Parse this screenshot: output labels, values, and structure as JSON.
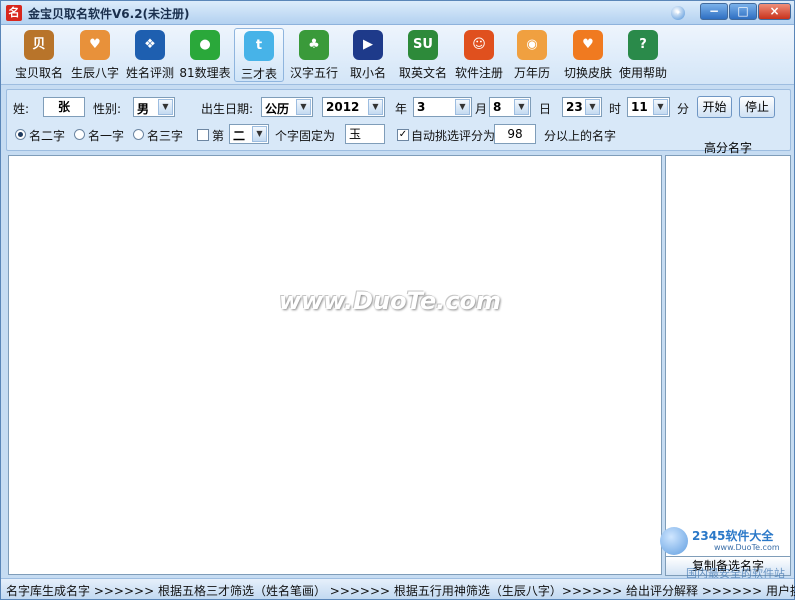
{
  "window": {
    "title": "金宝贝取名软件V6.2(未注册)"
  },
  "toolbar": [
    {
      "label": "宝贝取名",
      "icon": "baby-naming-icon",
      "color": "#b8742a",
      "glyph": "贝"
    },
    {
      "label": "生辰八字",
      "icon": "heart-hands-icon",
      "color": "#e8913a",
      "glyph": "♥"
    },
    {
      "label": "姓名评测",
      "icon": "name-test-icon",
      "color": "#1e5fb0",
      "glyph": "❖"
    },
    {
      "label": "81数理表",
      "icon": "chat-bubble-icon",
      "color": "#2aa83a",
      "glyph": "●"
    },
    {
      "label": "三才表",
      "icon": "bird-icon",
      "color": "#47b3e8",
      "glyph": "t"
    },
    {
      "label": "汉字五行",
      "icon": "users-icon",
      "color": "#3a9a3a",
      "glyph": "♣"
    },
    {
      "label": "取小名",
      "icon": "car-icon",
      "color": "#1e3a8a",
      "glyph": "▶"
    },
    {
      "label": "取英文名",
      "icon": "stumble-icon",
      "color": "#2d8a3a",
      "glyph": "SU"
    },
    {
      "label": "软件注册",
      "icon": "robot-icon",
      "color": "#e0501e",
      "glyph": "☺"
    },
    {
      "label": "万年历",
      "icon": "calendar-icon",
      "color": "#f0a040",
      "glyph": "◉"
    },
    {
      "label": "切换皮肤",
      "icon": "skin-heart-icon",
      "color": "#f07a20",
      "glyph": "♥"
    },
    {
      "label": "使用帮助",
      "icon": "help-book-icon",
      "color": "#2a8a4a",
      "glyph": "?"
    }
  ],
  "form": {
    "surname_label": "姓:",
    "surname_value": "张",
    "gender_label": "性别:",
    "gender_value": "男",
    "birth_label": "出生日期:",
    "calendar_value": "公历",
    "year_value": "2012",
    "year_label": "年",
    "month_value": "3",
    "month_label": "月",
    "day_value": "8",
    "day_label": "日",
    "hour_value": "23",
    "hour_label": "时",
    "minute_value": "11",
    "minute_label": "分",
    "start_label": "开始",
    "stop_label": "停止",
    "radio_two": "名二字",
    "radio_one": "名一字",
    "radio_three": "名三字",
    "nth_label": "第",
    "nth_value": "二",
    "fixed_label": "个字固定为",
    "fixed_value": "玉",
    "auto_label": "自动挑选评分为",
    "score_value": "98",
    "score_suffix": "分以上的名字"
  },
  "side": {
    "title": "高分名字",
    "copy_label": "复制备选名字"
  },
  "watermark": "www.DuoTe.com",
  "logo": {
    "brand": "2345软件大全",
    "url": "www.DuoTe.com",
    "sub": "国内最安全的软件站"
  },
  "status": "名字库生成名字 >>>>>> 根据五格三才筛选（姓名笔画） >>>>>> 根据五行用神筛选（生辰八字）>>>>>> 给出评分解释 >>>>>> 用户挑选"
}
